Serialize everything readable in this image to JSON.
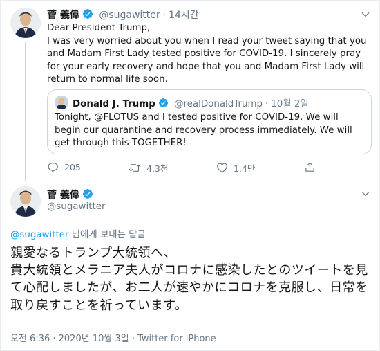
{
  "colors": {
    "accent": "#1da1f2",
    "muted": "#657786",
    "border": "#ccd6dd",
    "text": "#14171a"
  },
  "tweet1": {
    "author_name": "菅 義偉",
    "handle": "@sugawitter",
    "separator": "·",
    "time": "14시간",
    "body": "Dear President Trump,\nI was very worried about you when I read your tweet saying that you and Madam First Lady tested positive for COVID-19. I sincerely pray for your early recovery and hope that you and Madam First Lady will return to normal life soon.",
    "quote": {
      "author_name": "Donald J. Trump",
      "handle": "@realDonaldTrump",
      "separator": "·",
      "date": "10월 2일",
      "body": "Tonight, @FLOTUS and I tested positive for COVID-19. We will begin our quarantine and recovery process immediately. We will get through this TOGETHER!"
    },
    "actions": {
      "reply_count": "205",
      "retweet_count": "4.3천",
      "like_count": "1.4만"
    }
  },
  "tweet2": {
    "author_name": "菅 義偉",
    "handle": "@sugawitter",
    "replying_to_handle": "@sugawitter",
    "replying_to_suffix": " 님에게 보내는 답글",
    "body": "親愛なるトランプ大統領へ、\n貴大統領とメラニア夫人がコロナに感染したとのツイートを見て心配しましたが、お二人が速やかにコロナを克服し、日常を取り戻すことを祈っています。",
    "meta": "오전 6:36 · 2020년 10월 3일 · Twitter for iPhone"
  },
  "icons": [
    "verified-badge-icon",
    "chevron-down-icon",
    "reply-icon",
    "retweet-icon",
    "like-icon",
    "share-icon"
  ]
}
